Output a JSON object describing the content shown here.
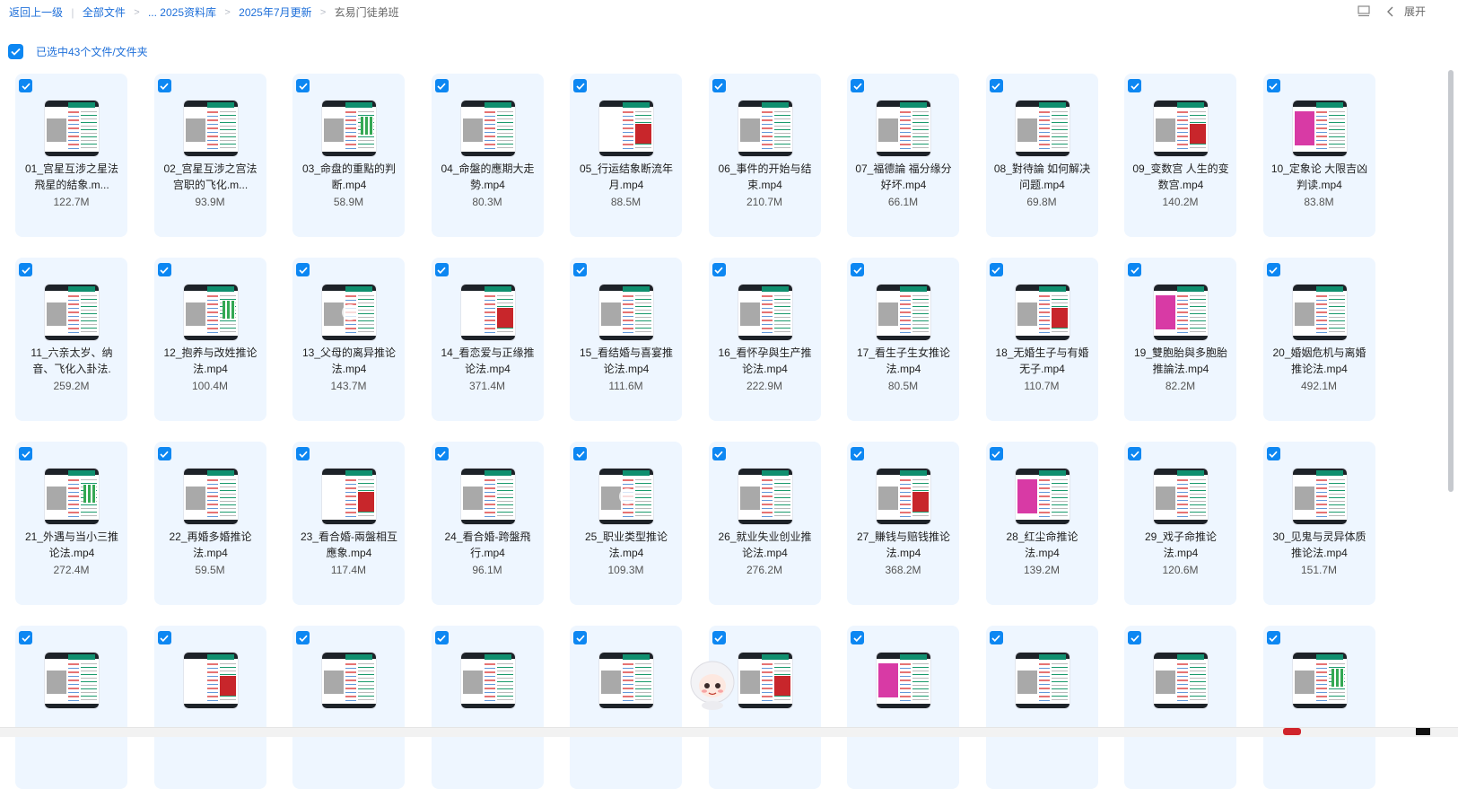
{
  "breadcrumb": {
    "back": "返回上一级",
    "items": [
      "全部文件",
      "... 2025资料库",
      "2025年7月更新"
    ],
    "current": "玄易门徒弟班"
  },
  "toolbar": {
    "expand_label": "展开"
  },
  "selection": {
    "label": "已选中43个文件/文件夹"
  },
  "files": [
    {
      "name": "01_宫星互涉之星法飛星的結象.m...",
      "size": "122.7M"
    },
    {
      "name": "02_宫星互涉之宫法 宫职的飞化.m...",
      "size": "93.9M"
    },
    {
      "name": "03_命盘的重點的判断.mp4",
      "size": "58.9M"
    },
    {
      "name": "04_命盤的應期大走勢.mp4",
      "size": "80.3M"
    },
    {
      "name": "05_行运结象断流年月.mp4",
      "size": "88.5M"
    },
    {
      "name": "06_事件的开始与结束.mp4",
      "size": "210.7M"
    },
    {
      "name": "07_福德論 福分缘分好坏.mp4",
      "size": "66.1M"
    },
    {
      "name": "08_對待論 如何解决问题.mp4",
      "size": "69.8M"
    },
    {
      "name": "09_变数宫 人生的变数宫.mp4",
      "size": "140.2M"
    },
    {
      "name": "10_定象论 大限吉凶判读.mp4",
      "size": "83.8M"
    },
    {
      "name": "11_六亲太岁、纳音、飞化入卦法.",
      "size": "259.2M"
    },
    {
      "name": "12_抱养与改姓推论法.mp4",
      "size": "100.4M"
    },
    {
      "name": "13_父母的离异推论法.mp4",
      "size": "143.7M"
    },
    {
      "name": "14_看恋爱与正缘推论法.mp4",
      "size": "371.4M"
    },
    {
      "name": "15_看结婚与喜宴推论法.mp4",
      "size": "111.6M"
    },
    {
      "name": "16_看怀孕與生产推论法.mp4",
      "size": "222.9M"
    },
    {
      "name": "17_看生子生女推论法.mp4",
      "size": "80.5M"
    },
    {
      "name": "18_无婚生子与有婚无子.mp4",
      "size": "110.7M"
    },
    {
      "name": "19_雙胞胎與多胞胎推論法.mp4",
      "size": "82.2M"
    },
    {
      "name": "20_婚姻危机与离婚推论法.mp4",
      "size": "492.1M"
    },
    {
      "name": "21_外遇与当小三推论法.mp4",
      "size": "272.4M"
    },
    {
      "name": "22_再婚多婚推论法.mp4",
      "size": "59.5M"
    },
    {
      "name": "23_看合婚-兩盤相互應象.mp4",
      "size": "117.4M"
    },
    {
      "name": "24_看合婚-跨盤飛行.mp4",
      "size": "96.1M"
    },
    {
      "name": "25_职业类型推论法.mp4",
      "size": "109.3M"
    },
    {
      "name": "26_就业失业创业推论法.mp4",
      "size": "276.2M"
    },
    {
      "name": "27_賺钱与赔钱推论法.mp4",
      "size": "368.2M"
    },
    {
      "name": "28_红尘命推论法.mp4",
      "size": "139.2M"
    },
    {
      "name": "29_戏子命推论法.mp4",
      "size": "120.6M"
    },
    {
      "name": "30_见鬼与灵异体质推论法.mp4",
      "size": "151.7M"
    },
    {
      "name": "",
      "size": ""
    },
    {
      "name": "",
      "size": ""
    },
    {
      "name": "",
      "size": ""
    },
    {
      "name": "",
      "size": ""
    },
    {
      "name": "",
      "size": ""
    },
    {
      "name": "",
      "size": ""
    },
    {
      "name": "",
      "size": ""
    },
    {
      "name": "",
      "size": ""
    },
    {
      "name": "",
      "size": ""
    },
    {
      "name": "",
      "size": ""
    }
  ],
  "icons": {
    "layout": "layout-icon",
    "chevron": "chevron-left-icon",
    "checkbox": "checkbox-checked-icon"
  },
  "colors": {
    "accent": "#0d87f2",
    "card_bg": "#eef6ff",
    "link": "#1e6fd9"
  }
}
